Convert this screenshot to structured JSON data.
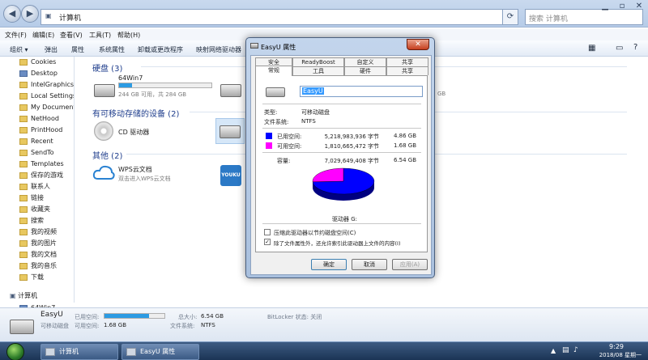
{
  "explorer": {
    "address": [
      "计算机"
    ],
    "search_placeholder": "搜索 计算机",
    "menu": [
      "文件(F)",
      "编辑(E)",
      "查看(V)",
      "工具(T)",
      "帮助(H)"
    ],
    "toolbar": [
      "组织 ▾",
      "弹出",
      "属性",
      "系统属性",
      "卸载或更改程序",
      "映射网络驱动器"
    ],
    "nav_items": [
      "Cookies",
      "Desktop",
      "IntelGraphicsP",
      "Local Settings",
      "My Documents",
      "NetHood",
      "PrintHood",
      "Recent",
      "SendTo",
      "Templates",
      "保存的游戏",
      "联系人",
      "链接",
      "收藏夹",
      "搜索",
      "我的视频",
      "我的图片",
      "我的文档",
      "我的音乐",
      "下载"
    ],
    "nav_pc": "计算机",
    "nav_pc_child": "64Win7",
    "groups": {
      "hard_disks": "硬盘 (3)",
      "removable": "有可移动存储的设备 (2)",
      "other": "其他 (2)"
    },
    "drive_c": {
      "name": "64Win7",
      "free": "244 GB 可用，共 284 GB",
      "used_fraction": 0.14
    },
    "drive_b_free": "GB",
    "cd_drive": "CD 驱动器",
    "wps": {
      "name": "WPS云文档",
      "sub": "双击进入WPS云文档"
    },
    "youku_label": "YOUKU",
    "details": {
      "name": "EasyU",
      "type": "可移动磁盘",
      "used_label": "已用空间:",
      "free_label": "可用空间:",
      "free_value": "1.68 GB",
      "total_label": "总大小:",
      "total_value": "6.54 GB",
      "fs_label": "文件系统:",
      "fs_value": "NTFS",
      "bitlocker": "BitLocker 状态: 关闭",
      "used_fraction": 0.74
    }
  },
  "dialog": {
    "title": "EasyU 属性",
    "close": "✕",
    "tabs_back": [
      "安全",
      "ReadyBoost",
      "自定义",
      "共享"
    ],
    "tabs_mid": [
      "常规",
      "工具",
      "硬件",
      "共享"
    ],
    "drive_name": "EasyU",
    "type_label": "类型:",
    "type_value": "可移动磁盘",
    "fs_label": "文件系统:",
    "fs_value": "NTFS",
    "used_label": "已用空间:",
    "used_bytes": "5,218,983,936 字节",
    "used_size": "4.86 GB",
    "free_label": "可用空间:",
    "free_bytes": "1,810,665,472 字节",
    "free_size": "1.68 GB",
    "capacity_label": "容量:",
    "capacity_bytes": "7,029,649,408 字节",
    "capacity_size": "6.54 GB",
    "drive_letter": "驱动器 G:",
    "compress_label": "压缩此驱动器以节约磁盘空间(C)",
    "index_label": "除了文件属性外，还允许索引此驱动器上文件的内容(I)",
    "ok": "确定",
    "cancel": "取消",
    "apply": "应用(A)",
    "used_fraction": 0.742,
    "colors": {
      "used": "#0000ff",
      "free": "#ff00ff"
    }
  },
  "taskbar": {
    "items": [
      "计算机",
      "EasyU 属性"
    ],
    "time": "9:29",
    "date": "2018/08 星期一"
  }
}
